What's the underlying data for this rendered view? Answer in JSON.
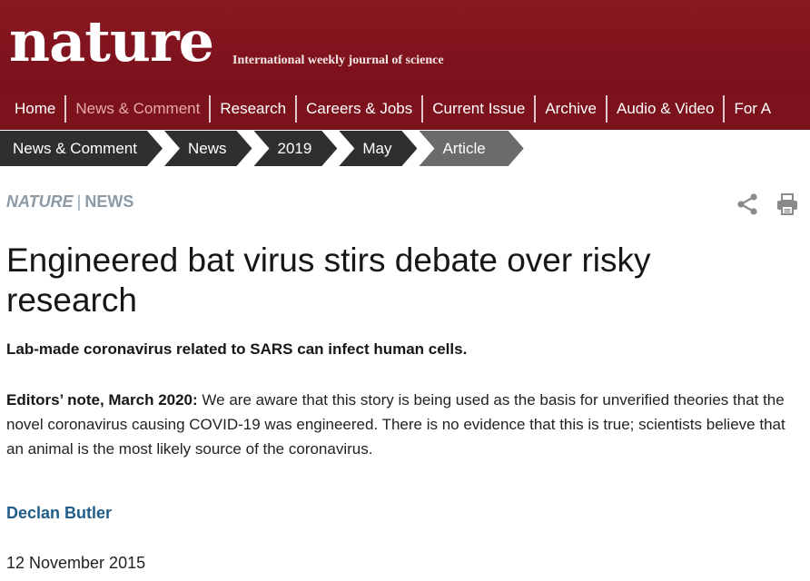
{
  "masthead": {
    "logo": "nature",
    "tagline": "International weekly journal of science"
  },
  "nav": {
    "items": [
      {
        "label": "Home"
      },
      {
        "label": "News & Comment"
      },
      {
        "label": "Research"
      },
      {
        "label": "Careers & Jobs"
      },
      {
        "label": "Current Issue"
      },
      {
        "label": "Archive"
      },
      {
        "label": "Audio & Video"
      },
      {
        "label": "For A"
      }
    ],
    "active_index": 1
  },
  "breadcrumb": [
    {
      "label": "News & Comment"
    },
    {
      "label": "News"
    },
    {
      "label": "2019"
    },
    {
      "label": "May"
    },
    {
      "label": "Article"
    }
  ],
  "article": {
    "journal": "NATURE",
    "section": "NEWS",
    "separator": "|",
    "title": "Engineered bat virus stirs debate over risky research",
    "standfirst": "Lab-made coronavirus related to SARS can infect human cells.",
    "note_lead": "Editors’ note, March 2020:",
    "note_body": " We are aware that this story is being used as the basis for unverified theories that the novel coronavirus causing COVID-19 was engineered. There is no evidence that this is true; scientists believe that an animal is the most likely source of the coronavirus.",
    "author": "Declan Butler",
    "date": "12 November 2015"
  },
  "tools": {
    "share_icon": "share-icon",
    "print_icon": "print-icon"
  },
  "colors": {
    "brand": "#7c121c",
    "active_nav": "#e9a8ae",
    "kicker": "#8c9aa6",
    "author": "#1f5e8a"
  }
}
